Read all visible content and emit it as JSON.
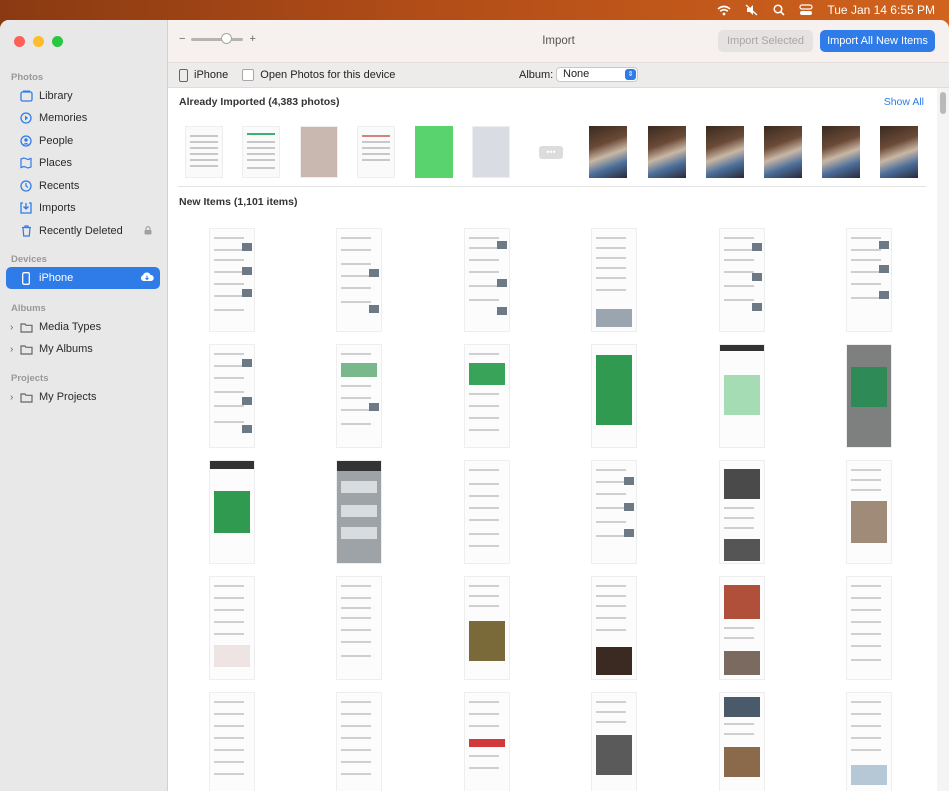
{
  "menubar": {
    "datetime": "Tue Jan 14  6:55 PM",
    "icons": [
      "wifi-icon",
      "mute-icon",
      "search-icon",
      "control-center-icon"
    ]
  },
  "window": {
    "title": "Import"
  },
  "toolbar": {
    "zoom_minus": "−",
    "zoom_plus": "+",
    "import_selected": "Import Selected",
    "import_all": "Import All New Items"
  },
  "sidebar": {
    "sections": {
      "photos": "Photos",
      "devices": "Devices",
      "albums": "Albums",
      "projects": "Projects"
    },
    "photos_items": [
      {
        "label": "Library",
        "icon": "library-icon"
      },
      {
        "label": "Memories",
        "icon": "memories-icon"
      },
      {
        "label": "People",
        "icon": "people-icon"
      },
      {
        "label": "Places",
        "icon": "places-icon"
      },
      {
        "label": "Recents",
        "icon": "recents-icon"
      },
      {
        "label": "Imports",
        "icon": "imports-icon"
      },
      {
        "label": "Recently Deleted",
        "icon": "trash-icon"
      }
    ],
    "device_item": {
      "label": "iPhone",
      "icon": "iphone-icon"
    },
    "album_items": [
      {
        "label": "Media Types"
      },
      {
        "label": "My Albums"
      }
    ],
    "project_items": [
      {
        "label": "My Projects"
      }
    ]
  },
  "devicebar": {
    "device": "iPhone",
    "open_photos_label": "Open Photos for this device",
    "open_photos_checked": false,
    "album_label": "Album:",
    "album_value": "None"
  },
  "content": {
    "already_imported": "Already Imported (4,383 photos)",
    "show_all": "Show All",
    "new_items": "New Items (1,101 items)"
  },
  "colors": {
    "accent": "#2f7ce8",
    "sidebar_bg": "#e9e8e9",
    "toolbar_bg": "#f6f0ee"
  }
}
